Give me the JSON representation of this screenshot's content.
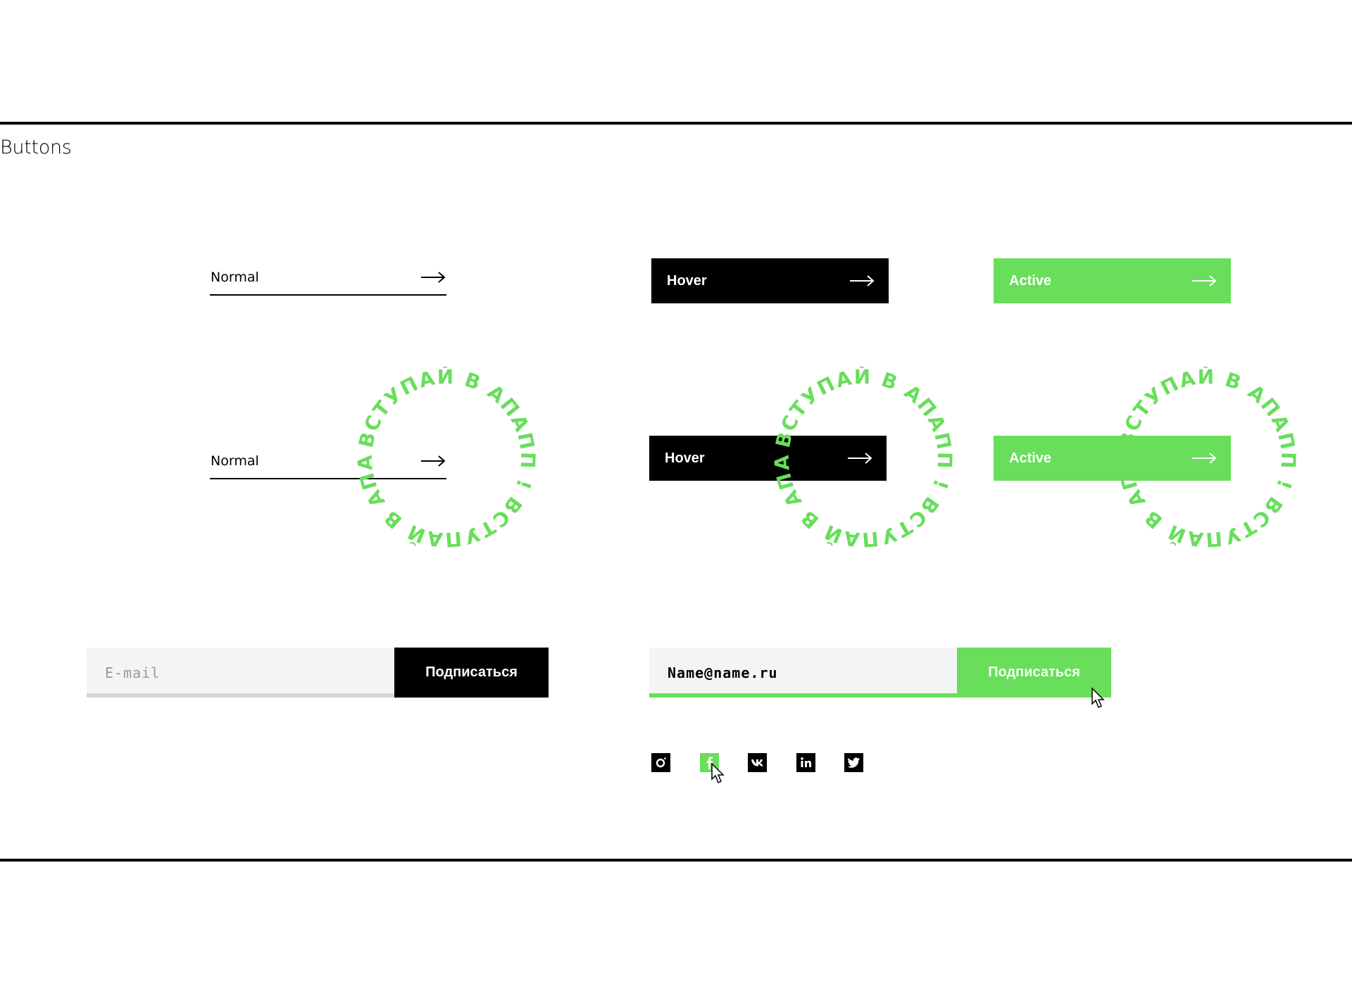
{
  "section": {
    "title": "Buttons"
  },
  "colors": {
    "accent": "#68de5b",
    "dark": "#000000",
    "field_bg": "#f4f4f4",
    "field_underline": "#d5d5d5"
  },
  "buttons": {
    "row1": {
      "normal": "Normal",
      "hover": "Hover",
      "active": "Active"
    },
    "row2": {
      "normal": "Normal",
      "hover": "Hover",
      "active": "Active"
    },
    "arrow_icon": "arrow-right-icon"
  },
  "badge": {
    "text": "ВСТУПАЙ В АПАПП ! ВСТУПАЙ В АПАПП ! "
  },
  "subscribe": {
    "default": {
      "placeholder": "E-mail",
      "button": "Подписаться"
    },
    "active": {
      "value": "Name@name.ru",
      "button": "Подписаться"
    }
  },
  "social": [
    {
      "name": "instagram",
      "icon": "instagram-icon",
      "highlighted": false
    },
    {
      "name": "facebook",
      "icon": "facebook-icon",
      "highlighted": true
    },
    {
      "name": "vk",
      "icon": "vk-icon",
      "highlighted": false
    },
    {
      "name": "linkedin",
      "icon": "linkedin-icon",
      "highlighted": false
    },
    {
      "name": "twitter",
      "icon": "twitter-icon",
      "highlighted": false
    }
  ]
}
